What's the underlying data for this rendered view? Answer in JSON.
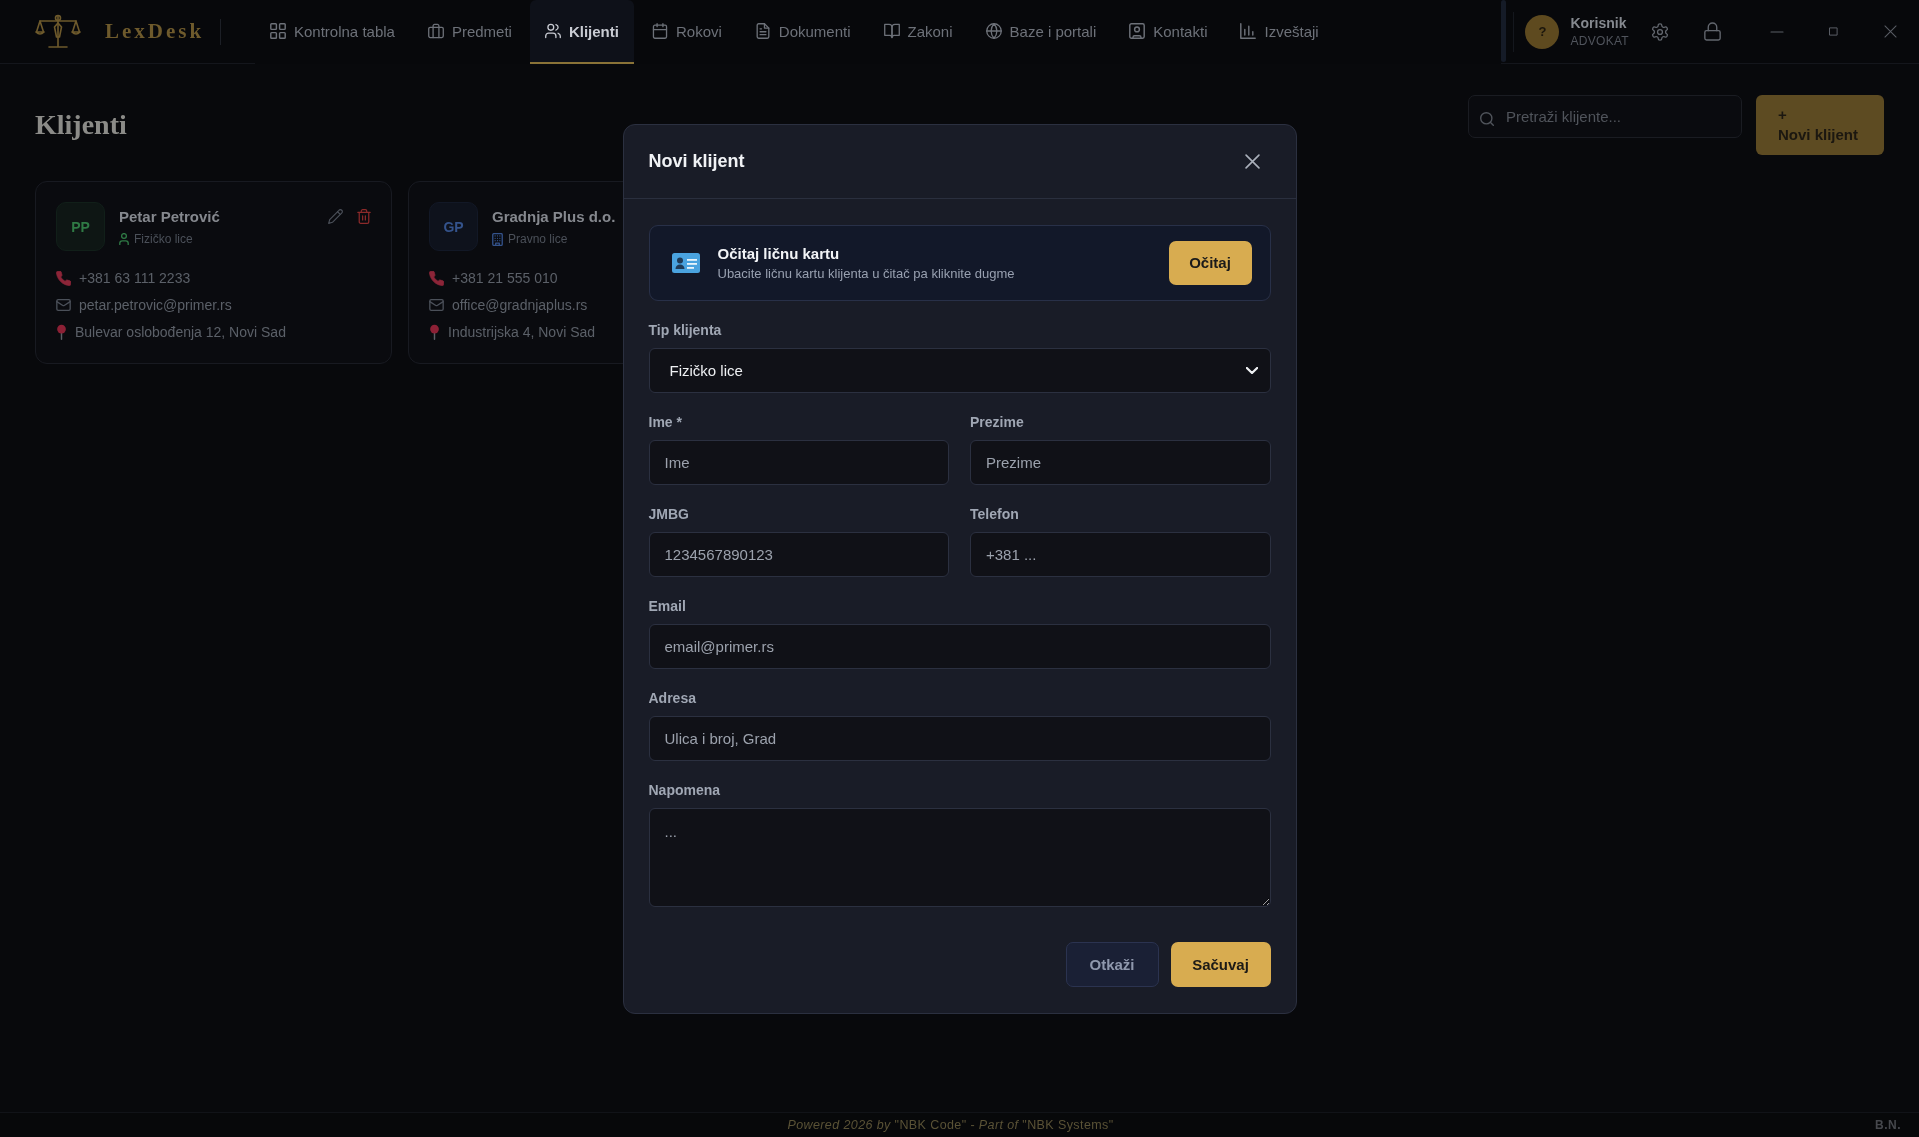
{
  "header": {
    "logo_text": "LexDesk",
    "nav": [
      {
        "label": "Kontrolna tabla",
        "selected": false
      },
      {
        "label": "Predmeti",
        "selected": false
      },
      {
        "label": "Klijenti",
        "selected": true
      },
      {
        "label": "Rokovi",
        "selected": false
      },
      {
        "label": "Dokumenti",
        "selected": false
      },
      {
        "label": "Zakoni",
        "selected": false
      },
      {
        "label": "Baze i portali",
        "selected": false
      },
      {
        "label": "Kontakti",
        "selected": false
      },
      {
        "label": "Izveštaji",
        "selected": false
      }
    ],
    "user": {
      "avatar": "?",
      "name": "Korisnik",
      "role": "ADVOKAT"
    }
  },
  "page": {
    "title": "Klijenti",
    "search": {
      "placeholder": "Pretraži klijente..."
    },
    "new_client_button": {
      "icon": "+",
      "label": "Novi klijent"
    }
  },
  "clients": [
    {
      "kind": "person",
      "initials": "PP",
      "color": "#2f7a45",
      "name": "Petar Petrović",
      "type": "Fizičko lice",
      "phone": "+381 63 111 2233",
      "email": "petar.petrovic@primer.rs",
      "address": "Bulevar oslobođenja 12, Novi Sad"
    },
    {
      "kind": "company",
      "initials": "GP",
      "color": "#34538c",
      "name": "Gradnja Plus d.o.",
      "type": "Pravno lice",
      "phone": "+381 21 555 010",
      "email": "office@gradnjaplus.rs",
      "address": "Industrijska 4, Novi Sad"
    }
  ],
  "dialog": {
    "title": "Novi klijent",
    "id_reader": {
      "title": "Očitaj ličnu kartu",
      "hint": "Ubacite ličnu kartu klijenta u čitač pa kliknite dugme",
      "button": "Očitaj"
    },
    "rows": [
      [
        {
          "kind": "select",
          "label": "Tip klijenta",
          "value": "Fizičko lice"
        }
      ],
      [
        {
          "kind": "text",
          "label": "Ime *",
          "placeholder": "Ime"
        },
        {
          "kind": "text",
          "label": "Prezime",
          "placeholder": "Prezime"
        }
      ],
      [
        {
          "kind": "text",
          "label": "JMBG",
          "placeholder": "1234567890123"
        },
        {
          "kind": "text",
          "label": "Telefon",
          "placeholder": "+381 ..."
        }
      ],
      [
        {
          "kind": "text",
          "label": "Email",
          "placeholder": "email@primer.rs"
        }
      ],
      [
        {
          "kind": "text",
          "label": "Adresa",
          "placeholder": "Ulica i broj, Grad"
        }
      ],
      [
        {
          "kind": "textarea",
          "label": "Napomena",
          "placeholder": "..."
        }
      ]
    ],
    "buttons": [
      {
        "kind": "secondary",
        "label": "Otkaži"
      },
      {
        "kind": "primary",
        "label": "Sačuvaj"
      }
    ]
  },
  "footer": {
    "credit": "*Powered 2026 by* \"NBK Code\" - *Part of* \"NBK Systems\"",
    "initials": "B.N."
  }
}
